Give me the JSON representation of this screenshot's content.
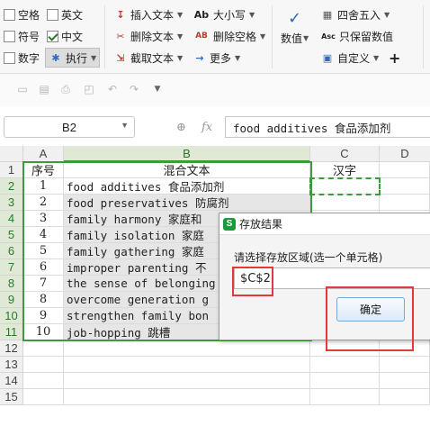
{
  "ribbon": {
    "checkboxes": [
      {
        "label": "空格",
        "checked": false
      },
      {
        "label": "英文",
        "checked": false
      },
      {
        "label": "符号",
        "checked": false
      },
      {
        "label": "中文",
        "checked": true
      },
      {
        "label": "数字",
        "checked": false
      }
    ],
    "execute_label": "执行",
    "insert_text_label": "插入文本",
    "delete_text_label": "删除文本",
    "extract_text_label": "截取文本",
    "case_label": "大小写",
    "case_icon": "Ab",
    "delete_space_label": "删除空格",
    "delete_space_icon": "AB",
    "more_label": "更多",
    "value_label": "数值",
    "round_label": "四舍五入",
    "keep_value_label": "只保留数值",
    "keep_value_icon": "Asc",
    "custom_label": "自定义",
    "plus_label": "+"
  },
  "formula_bar": {
    "name_box": "B2",
    "fx_label": "fx",
    "content": "food additives 食品添加剂"
  },
  "sheet": {
    "columns": [
      "A",
      "B",
      "C",
      "D"
    ],
    "rows": [
      "1",
      "2",
      "3",
      "4",
      "5",
      "6",
      "7",
      "8",
      "9",
      "10",
      "11",
      "12",
      "13",
      "14",
      "15"
    ],
    "header": [
      "序号",
      "混合文本",
      "汉字"
    ],
    "data": [
      {
        "no": "1",
        "text": "food additives 食品添加剂"
      },
      {
        "no": "2",
        "text": "food preservatives 防腐剂"
      },
      {
        "no": "3",
        "text": "family harmony 家庭和"
      },
      {
        "no": "4",
        "text": "family isolation 家庭"
      },
      {
        "no": "5",
        "text": "family gathering 家庭"
      },
      {
        "no": "6",
        "text": "improper parenting 不"
      },
      {
        "no": "7",
        "text": "the sense of belonging"
      },
      {
        "no": "8",
        "text": "overcome generation g"
      },
      {
        "no": "9",
        "text": "strengthen family bon"
      },
      {
        "no": "10",
        "text": "job-hopping 跳槽"
      }
    ]
  },
  "dialog": {
    "title": "存放结果",
    "app_icon": "S",
    "prompt": "请选择存放区域(选一个单元格)",
    "input_value": "$C$2",
    "ok_label": "确定"
  },
  "colors": {
    "accent_green": "#3c9b3c",
    "highlight_red": "#e23a3a"
  }
}
